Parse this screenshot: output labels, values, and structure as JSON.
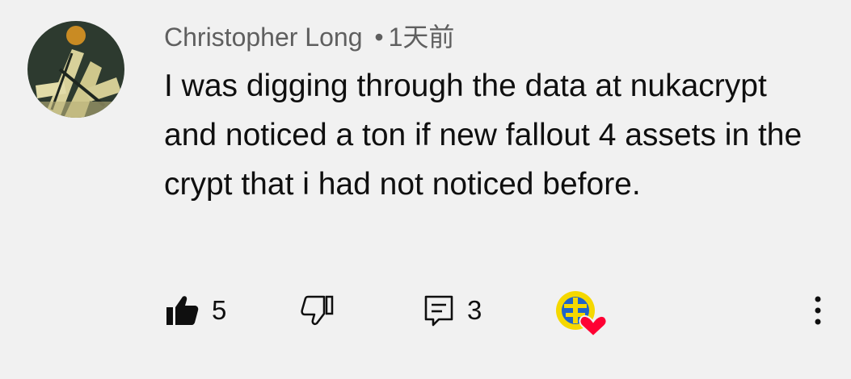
{
  "comment": {
    "author": "Christopher Long",
    "separator": "•",
    "timestamp": "1天前",
    "text": "I was digging through the data at nukacrypt and noticed a ton if new fallout 4 assets in the crypt that i had not noticed before.",
    "avatar_icon": "avatar-image",
    "likes": "5",
    "replies": "3",
    "creator_heart": true
  },
  "icons": {
    "like": "thumbs-up-icon",
    "dislike": "thumbs-down-icon",
    "reply": "comment-reply-icon",
    "heart": "creator-heart-icon",
    "more": "more-vertical-icon"
  },
  "colors": {
    "background": "#f1f1f1",
    "text": "#0f0f0f",
    "meta": "#5f5f5f",
    "heart": "#ff0033"
  }
}
